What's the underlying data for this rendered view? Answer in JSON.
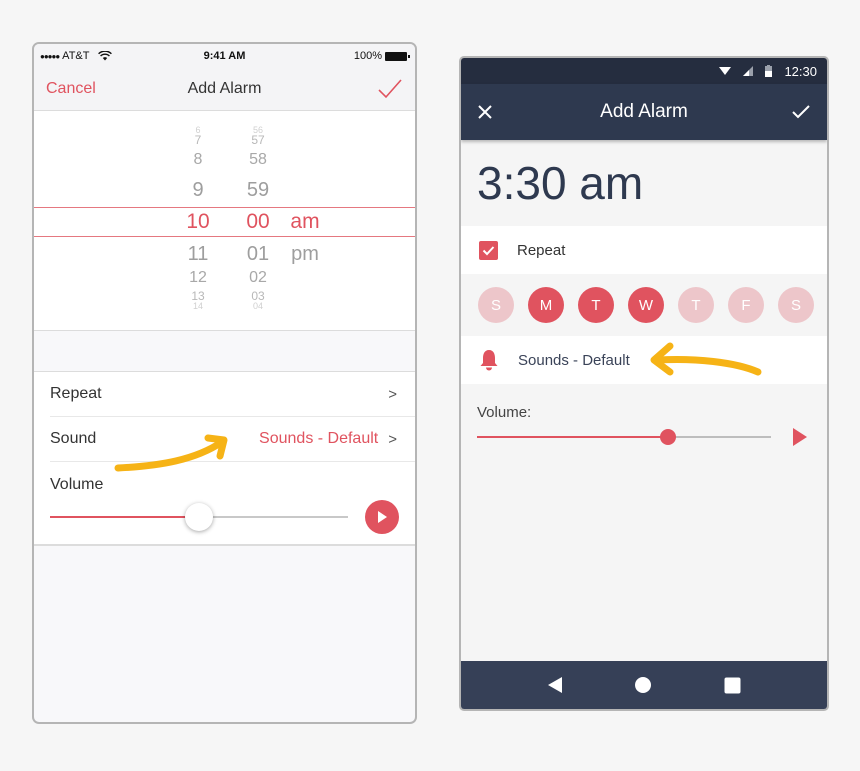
{
  "ios": {
    "status": {
      "carrier": "AT&T",
      "signal_dots": 5,
      "time": "9:41 AM",
      "battery": "100%"
    },
    "nav": {
      "cancel_label": "Cancel",
      "title": "Add Alarm",
      "done_icon": "checkmark-icon"
    },
    "picker": {
      "hours": [
        "6",
        "7",
        "8",
        "9",
        "10",
        "11",
        "12",
        "13",
        "14"
      ],
      "minutes": [
        "56",
        "57",
        "58",
        "59",
        "00",
        "01",
        "02",
        "03",
        "04"
      ],
      "periods": [
        "am",
        "pm"
      ],
      "selected": {
        "hour": "10",
        "minute": "00",
        "period": "am"
      }
    },
    "rows": {
      "repeat_label": "Repeat",
      "sound_label": "Sound",
      "sound_value": "Sounds - Default",
      "volume_label": "Volume"
    },
    "volume_level": 0.5
  },
  "android": {
    "status": {
      "time": "12:30"
    },
    "bar": {
      "title": "Add Alarm",
      "close_icon": "close-icon",
      "done_icon": "check-icon"
    },
    "time_display": "3:30 am",
    "repeat": {
      "label": "Repeat",
      "checked": true
    },
    "days": [
      {
        "label": "S",
        "selected": false
      },
      {
        "label": "M",
        "selected": true
      },
      {
        "label": "T",
        "selected": true
      },
      {
        "label": "W",
        "selected": true
      },
      {
        "label": "T",
        "selected": false
      },
      {
        "label": "F",
        "selected": false
      },
      {
        "label": "S",
        "selected": false
      }
    ],
    "sound": {
      "label": "Sounds - Default",
      "icon": "bell-icon"
    },
    "volume": {
      "label": "Volume:",
      "level": 0.65
    }
  },
  "colors": {
    "accent": "#e0535f",
    "android_dark": "#2e394f",
    "annotation_arrow": "#f6b316"
  }
}
